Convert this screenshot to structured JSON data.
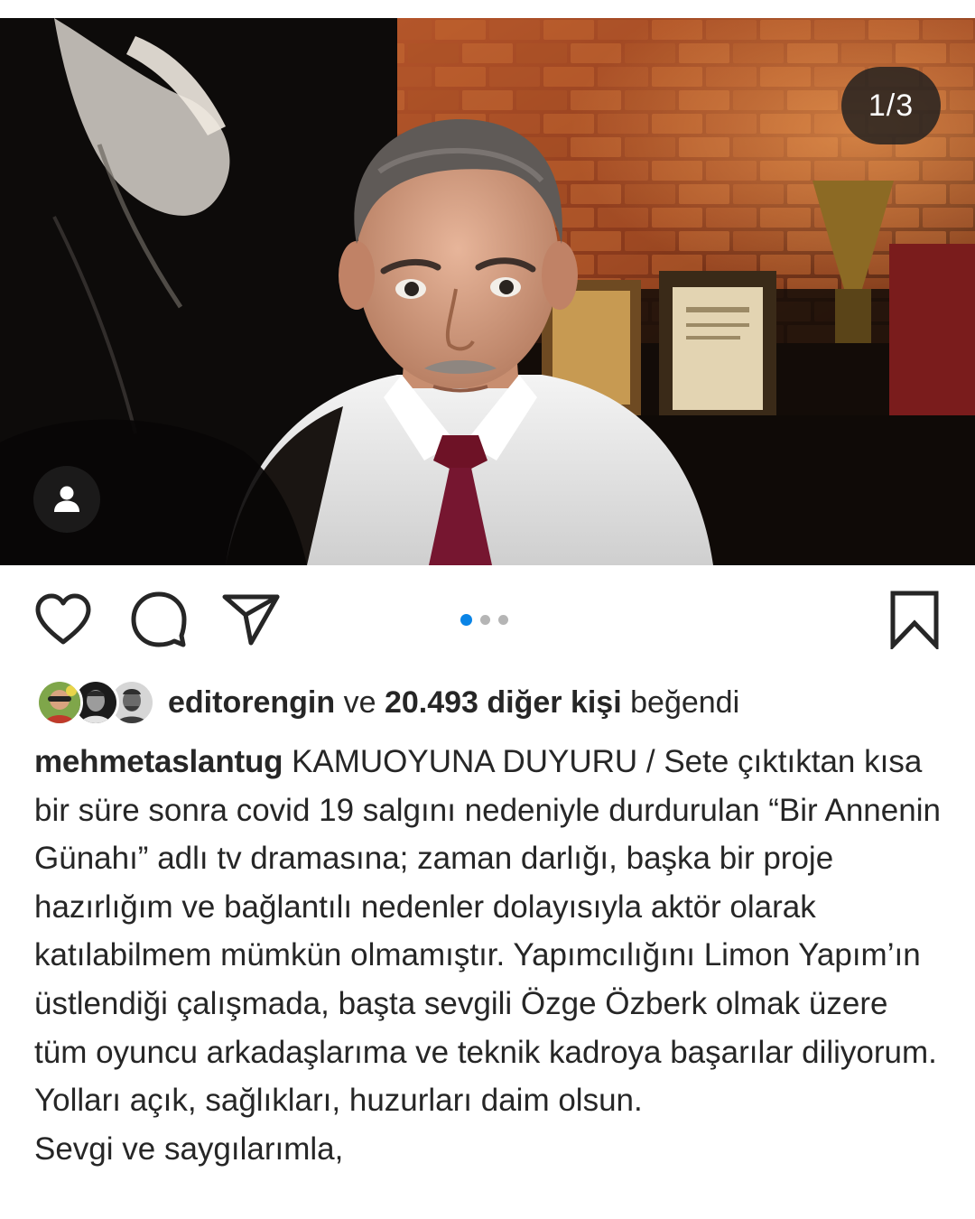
{
  "post": {
    "page_counter": "1/3",
    "carousel": {
      "total": 3,
      "active_index": 0
    }
  },
  "icons": {
    "tag": "person-icon",
    "like": "heart-outline-icon",
    "comment": "comment-bubble-icon",
    "share": "paper-plane-icon",
    "save": "bookmark-outline-icon"
  },
  "likes": {
    "first_liker": "editorengin",
    "connector": "ve",
    "others_count": "20.493 diğer kişi",
    "suffix": "beğendi"
  },
  "caption": {
    "username": "mehmetaslantug",
    "text": "KAMUOYUNA DUYURU / Sete çıktıktan kısa bir süre sonra covid 19 salgını nedeniyle durdurulan “Bir Annenin Günahı” adlı tv dramasına; zaman darlığı, başka bir proje hazırlığım ve bağlantılı nedenler dolayısıyla aktör olarak katılabilmem mümkün olmamıştır. Yapımcılığını Limon Yapım’ın üstlendiği çalışmada, başta sevgili Özge Özberk olmak üzere tüm oyuncu arkadaşlarıma ve teknik kadroya başarılar diliyorum. Yolları açık, sağlıkları, huzurları daim olsun.\nSevgi ve saygılarımla,"
  },
  "colors": {
    "text": "#262626",
    "active_dot": "#0a84e6",
    "inactive_dot": "#b5b5b5",
    "overlay": "#1e1e1e"
  }
}
